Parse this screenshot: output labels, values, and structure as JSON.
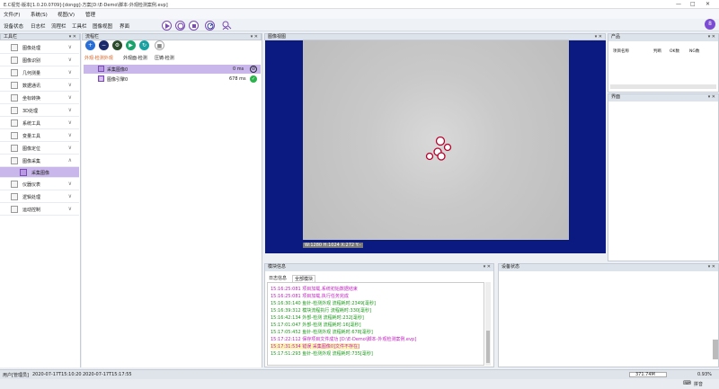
{
  "window": {
    "title": "E.C视觉-版本[1.0.20.0709]-[dongg]-方案[D:\\E-Demo\\脚本-外观检测案例.evp]"
  },
  "menu": [
    "文件(F)",
    "系统(S)",
    "视图(V)",
    "管理"
  ],
  "toolbar": {
    "labels": [
      "设备状态",
      "日志栏",
      "流程栏",
      "工具栏",
      "图像视图",
      "界面"
    ]
  },
  "avatar": "8",
  "toolbox": {
    "title": "工具栏",
    "items": [
      {
        "label": "图像处理"
      },
      {
        "label": "图像识别"
      },
      {
        "label": "几何测量"
      },
      {
        "label": "数据通讯"
      },
      {
        "label": "坐标转换"
      },
      {
        "label": "3D处理"
      },
      {
        "label": "系统工具"
      },
      {
        "label": "变量工具"
      },
      {
        "label": "图像定位"
      },
      {
        "label": "图像采集"
      },
      {
        "label": "采集图像",
        "sub": true
      },
      {
        "label": "仪器仪表"
      },
      {
        "label": "逻辑处理"
      },
      {
        "label": "运动控制"
      }
    ]
  },
  "flow": {
    "title": "流程栏",
    "tabs": [
      "外观-检测外观",
      "外观面-检测",
      "压铸-检测"
    ],
    "rows": [
      {
        "name": "采集图像0",
        "time": "0 ms",
        "status": "running"
      },
      {
        "name": "图像引擎0",
        "time": "678 ms",
        "status": "ok"
      }
    ]
  },
  "image_view": {
    "title": "图像视图",
    "info": "W:1280 H:1024 X:272 Y:-"
  },
  "product": {
    "title": "产品",
    "columns": [
      "项目名称",
      "判断",
      "OK数",
      "NG数"
    ]
  },
  "iface": {
    "title": "界面"
  },
  "log": {
    "title": "模块信息",
    "tabs": [
      "日志信息",
      "全部模块"
    ],
    "lines": [
      {
        "text": "15:16:25:081  项目加载,系统初始数据结束",
        "color": "#c020c0"
      },
      {
        "text": "15:16:25:081  项目加载,执行任务完成",
        "color": "#c020c0"
      },
      {
        "text": "15:16:30:140 鱼针-检测外观 流程耗时:2349[毫秒]",
        "color": "#1a9a1a"
      },
      {
        "text": "15:16:39:312 模块流程执行 流程耗时:330[毫秒]",
        "color": "#1a9a1a"
      },
      {
        "text": "15:16:42:134 外部-检测 流程耗时:232[毫秒]",
        "color": "#1a9a1a"
      },
      {
        "text": "15:17:01:047 外部-检测 流程耗时:16[毫秒]",
        "color": "#1a9a1a"
      },
      {
        "text": "15:17:05:452 鱼针-检测外观 流程耗时:678[毫秒]",
        "color": "#1a9a1a"
      },
      {
        "text": "15:17:22:112  保存项目文件成功 [D:\\E-Demo\\脚本-外观检测案例.evp]",
        "color": "#c020c0"
      },
      {
        "text": "15:17:31:534 错误 采集图像0]文件不存在]",
        "color": "#c020c0"
      },
      {
        "text": "15:17:51:293 鱼针-检测外观 流程耗时:735[毫秒]",
        "color": "#1a9a1a"
      }
    ]
  },
  "device": {
    "title": "设备状态"
  },
  "status": {
    "user": "用户[管理员]",
    "start": "2020-07-17T15:10:20",
    "now": "2020-07-17T15:17:55",
    "mem": "371.74M",
    "cpu": "0.93%"
  },
  "taskbar": {
    "ime": "拼音"
  },
  "colors": {
    "accent": "#7a4bb0",
    "viewer_bg": "#0a1a80"
  }
}
